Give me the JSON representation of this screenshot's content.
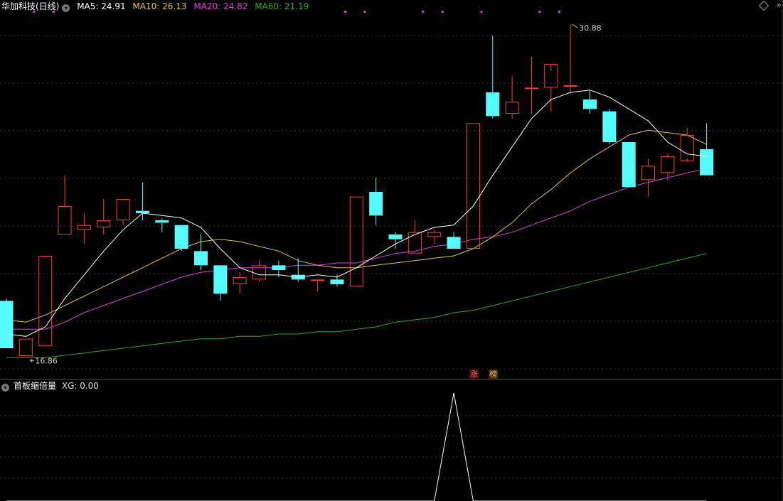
{
  "header": {
    "title": "华加科技(日线)",
    "ma5": "MA5: 24.91",
    "ma10": "MA10: 26.13",
    "ma20": "MA20: 24.82",
    "ma60": "MA60: 21.19",
    "menu_glyph": "»"
  },
  "indicator": {
    "name": "首板缩倍量",
    "value": "XG: 0.00"
  },
  "tags": {
    "up": "涨",
    "rank": "榜"
  },
  "colors": {
    "background": "#000000",
    "up": "#ff3c3c",
    "down": "#54fcfc",
    "ma5": "#ffffff",
    "ma10": "#e6c24a",
    "ma20": "#e040e0",
    "ma60": "#2ea82e",
    "grid": "#3a3a3a",
    "signal": "#ffffff"
  },
  "chart_data": [
    {
      "type": "candlestick",
      "title": "华加科技(日线)",
      "ylim": [
        16.3,
        31.3
      ],
      "grid": true,
      "max_label": "30.88",
      "min_label": "16.86",
      "candles": [
        {
          "o": 19.2,
          "h": 19.3,
          "l": 17.2,
          "c": 17.2
        },
        {
          "o": 16.87,
          "h": 17.6,
          "l": 16.86,
          "c": 17.6
        },
        {
          "o": 17.3,
          "h": 21.1,
          "l": 17.3,
          "c": 21.1
        },
        {
          "o": 22.0,
          "h": 24.5,
          "l": 22.0,
          "c": 23.2
        },
        {
          "o": 22.2,
          "h": 22.9,
          "l": 21.6,
          "c": 22.4
        },
        {
          "o": 22.3,
          "h": 23.5,
          "l": 22.0,
          "c": 22.6
        },
        {
          "o": 22.6,
          "h": 23.5,
          "l": 22.4,
          "c": 23.5
        },
        {
          "o": 23.0,
          "h": 24.2,
          "l": 22.6,
          "c": 22.9
        },
        {
          "o": 22.6,
          "h": 22.7,
          "l": 22.1,
          "c": 22.5
        },
        {
          "o": 22.4,
          "h": 22.4,
          "l": 21.3,
          "c": 21.4
        },
        {
          "o": 21.3,
          "h": 22.0,
          "l": 20.5,
          "c": 20.7
        },
        {
          "o": 20.7,
          "h": 20.7,
          "l": 19.2,
          "c": 19.5
        },
        {
          "o": 19.9,
          "h": 20.4,
          "l": 19.5,
          "c": 20.2
        },
        {
          "o": 20.1,
          "h": 20.9,
          "l": 20.0,
          "c": 20.7
        },
        {
          "o": 20.7,
          "h": 20.9,
          "l": 20.2,
          "c": 20.5
        },
        {
          "o": 20.3,
          "h": 21.0,
          "l": 20.0,
          "c": 20.1
        },
        {
          "o": 20.1,
          "h": 20.1,
          "l": 19.6,
          "c": 20.1
        },
        {
          "o": 20.1,
          "h": 20.3,
          "l": 19.8,
          "c": 19.9
        },
        {
          "o": 19.8,
          "h": 23.6,
          "l": 19.8,
          "c": 23.6
        },
        {
          "o": 23.8,
          "h": 24.4,
          "l": 22.4,
          "c": 22.8
        },
        {
          "o": 22.0,
          "h": 22.1,
          "l": 21.4,
          "c": 21.8
        },
        {
          "o": 21.2,
          "h": 22.6,
          "l": 21.2,
          "c": 22.1
        },
        {
          "o": 21.9,
          "h": 22.2,
          "l": 21.6,
          "c": 22.1
        },
        {
          "o": 21.9,
          "h": 22.1,
          "l": 21.4,
          "c": 21.4
        },
        {
          "o": 21.4,
          "h": 26.7,
          "l": 21.4,
          "c": 26.7
        },
        {
          "o": 28.0,
          "h": 30.4,
          "l": 26.9,
          "c": 27.0
        },
        {
          "o": 27.1,
          "h": 28.7,
          "l": 26.9,
          "c": 27.6
        },
        {
          "o": 28.2,
          "h": 29.5,
          "l": 27.1,
          "c": 28.2
        },
        {
          "o": 28.2,
          "h": 28.9,
          "l": 27.2,
          "c": 29.2
        },
        {
          "o": 28.3,
          "h": 30.88,
          "l": 27.9,
          "c": 28.3
        },
        {
          "o": 27.7,
          "h": 28.1,
          "l": 27.1,
          "c": 27.3
        },
        {
          "o": 27.2,
          "h": 27.3,
          "l": 25.8,
          "c": 25.9
        },
        {
          "o": 25.9,
          "h": 25.9,
          "l": 24.0,
          "c": 24.0
        },
        {
          "o": 24.3,
          "h": 25.2,
          "l": 23.6,
          "c": 24.9
        },
        {
          "o": 24.6,
          "h": 25.4,
          "l": 24.3,
          "c": 25.3
        },
        {
          "o": 25.1,
          "h": 26.5,
          "l": 25.2,
          "c": 26.2
        },
        {
          "o": 25.6,
          "h": 26.7,
          "l": 24.5,
          "c": 24.5
        }
      ],
      "series": [
        {
          "name": "MA5",
          "values": [
            17.8,
            17.7,
            18.1,
            19.3,
            20.3,
            21.3,
            22.2,
            22.9,
            22.8,
            22.7,
            22.3,
            21.4,
            20.6,
            20.3,
            20.3,
            20.2,
            20.3,
            20.2,
            20.6,
            21.1,
            21.6,
            22.0,
            22.3,
            22.4,
            23.2,
            24.5,
            25.7,
            26.9,
            27.7,
            28.0,
            28.1,
            27.8,
            27.3,
            26.8,
            25.9,
            25.4,
            25.3
          ]
        },
        {
          "name": "MA10",
          "values": [
            18.4,
            18.3,
            18.6,
            19.0,
            19.4,
            19.8,
            20.2,
            20.6,
            21.0,
            21.4,
            21.7,
            21.8,
            21.7,
            21.5,
            21.3,
            20.9,
            20.7,
            20.6,
            20.6,
            20.7,
            20.8,
            20.9,
            21.0,
            21.1,
            21.4,
            21.9,
            22.5,
            23.3,
            23.9,
            24.6,
            25.2,
            25.7,
            26.2,
            26.4,
            26.3,
            26.2,
            25.8
          ]
        },
        {
          "name": "MA20",
          "values": [
            18.0,
            18.0,
            18.0,
            18.3,
            18.7,
            19.0,
            19.3,
            19.6,
            19.9,
            20.2,
            20.4,
            20.5,
            20.6,
            20.6,
            20.6,
            20.7,
            20.7,
            20.8,
            20.8,
            21.0,
            21.2,
            21.3,
            21.5,
            21.6,
            21.8,
            21.9,
            22.1,
            22.4,
            22.7,
            23.0,
            23.4,
            23.7,
            24.0,
            24.2,
            24.4,
            24.6,
            24.8
          ]
        },
        {
          "name": "MA60",
          "values": [
            16.8,
            16.8,
            16.8,
            16.9,
            17.0,
            17.1,
            17.2,
            17.3,
            17.4,
            17.5,
            17.6,
            17.6,
            17.7,
            17.7,
            17.8,
            17.8,
            17.9,
            17.9,
            18.0,
            18.1,
            18.3,
            18.4,
            18.5,
            18.7,
            18.8,
            19.0,
            19.2,
            19.4,
            19.6,
            19.8,
            20.0,
            20.2,
            20.4,
            20.6,
            20.8,
            21.0,
            21.2
          ]
        }
      ]
    },
    {
      "type": "line",
      "title": "首板缩倍量",
      "series": [
        {
          "name": "XG",
          "values": [
            0,
            0,
            0,
            0,
            0,
            0,
            0,
            0,
            0,
            0,
            0,
            0,
            0,
            0,
            0,
            0,
            0,
            0,
            0,
            0,
            0,
            0,
            0,
            1,
            0,
            0,
            0,
            0,
            0,
            0,
            0,
            0,
            0,
            0,
            0,
            0,
            0
          ]
        }
      ]
    }
  ]
}
